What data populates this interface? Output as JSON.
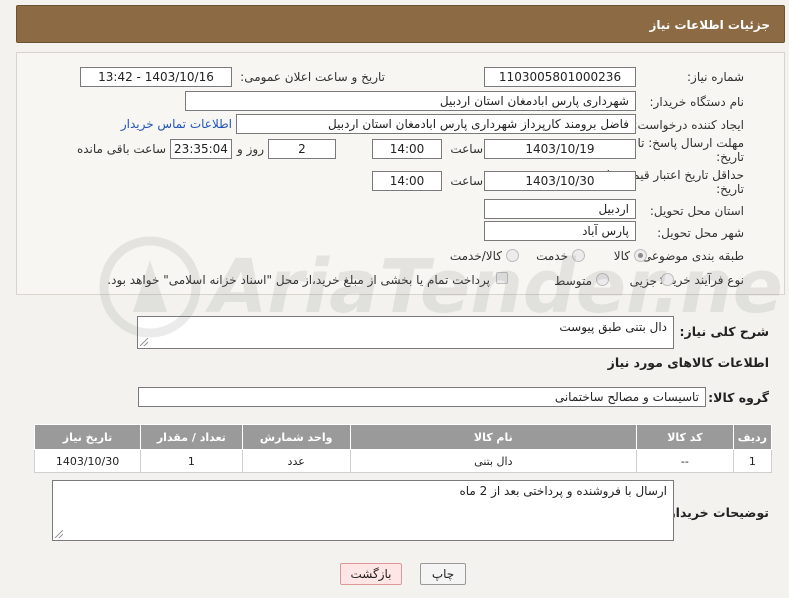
{
  "header": {
    "title": "جزئیات اطلاعات نیاز"
  },
  "form": {
    "need_number_label": "شماره نیاز:",
    "need_number": "1103005801000236",
    "announce_label": "تاریخ و ساعت اعلان عمومی:",
    "announce_value": "1403/10/16 - 13:42",
    "buyer_label": "نام دستگاه خریدار:",
    "buyer_value": "شهرداری پارس ابادمغان استان اردبیل",
    "creator_label": "ایجاد کننده درخواست:",
    "creator_value": "فاضل برومند کارپرداز شهرداری پارس ابادمغان استان اردبیل",
    "contact_link": "اطلاعات تماس خریدار",
    "deadline_label_1": "مهلت ارسال پاسخ: تا",
    "deadline_label_2": "تاریخ:",
    "deadline_date": "1403/10/19",
    "time_label": "ساعت",
    "deadline_time": "14:00",
    "days_value": "2",
    "days_label": "روز و",
    "remaining_value": "23:35:04",
    "remaining_label": "ساعت باقی مانده",
    "price_label_1": "حداقل تاریخ اعتبار قیمت: تا",
    "price_label_2": "تاریخ:",
    "price_date": "1403/10/30",
    "price_time": "14:00",
    "province_label": "استان محل تحویل:",
    "province_value": "اردبیل",
    "city_label": "شهر محل تحویل:",
    "city_value": "پارس آباد",
    "category_label": "طبقه بندی موضوعی:",
    "category_options": [
      "کالا",
      "خدمت",
      "کالا/خدمت"
    ],
    "process_label": "نوع فرآیند خرید :",
    "process_options": [
      "جزیی",
      "متوسط"
    ],
    "payment_note": "پرداخت تمام یا بخشی از مبلغ خرید،از محل \"اسناد خزانه اسلامی\" خواهد بود."
  },
  "summary": {
    "label": "شرح کلی نیاز:",
    "value": "دال بتنی طبق پیوست"
  },
  "goods": {
    "section_title": "اطلاعات کالاهای مورد نیاز",
    "group_label": "گروه کالا:",
    "group_value": "تاسیسات و مصالح ساختمانی",
    "columns": [
      "ردیف",
      "کد کالا",
      "نام کالا",
      "واحد شمارش",
      "تعداد / مقدار",
      "تاریخ نیاز"
    ],
    "rows": [
      [
        "1",
        "--",
        "دال بتنی",
        "عدد",
        "1",
        "1403/10/30"
      ]
    ]
  },
  "buyer_notes": {
    "label": "توضیحات خریدار:",
    "value": "ارسال با فروشنده و پرداختی بعد از 2 ماه"
  },
  "buttons": {
    "print": "چاپ",
    "back": "بازگشت"
  },
  "watermark": {
    "text": "AriaTender.neT"
  }
}
